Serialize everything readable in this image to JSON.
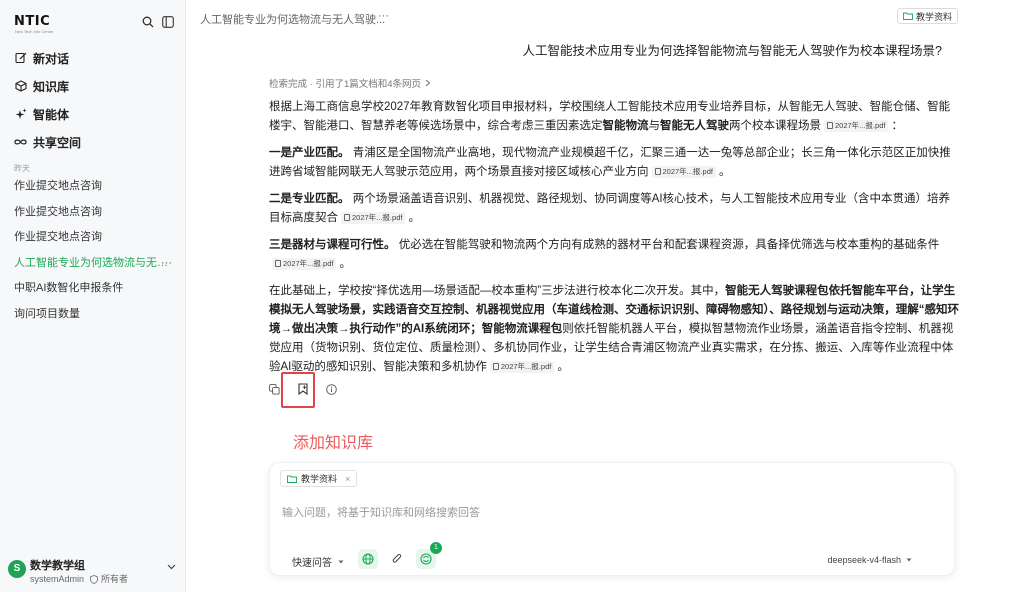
{
  "sidebar": {
    "logo": "NTIC",
    "logo_sub": "New Tech Info Center",
    "nav": [
      {
        "label": "新对话",
        "icon": "edit-icon"
      },
      {
        "label": "知识库",
        "icon": "cube-icon"
      },
      {
        "label": "智能体",
        "icon": "sparkle-icon"
      },
      {
        "label": "共享空间",
        "icon": "infinity-icon"
      }
    ],
    "section_label": "昨天",
    "history": [
      {
        "label": "作业提交地点咨询"
      },
      {
        "label": "作业提交地点咨询"
      },
      {
        "label": "作业提交地点咨询"
      },
      {
        "label": "人工智能专业为何选物流与无…",
        "active": true,
        "more": "···"
      },
      {
        "label": "中职AI数智化申报条件"
      },
      {
        "label": "询问项目数量"
      }
    ],
    "group": {
      "avatar": "S",
      "name": "数学教学组",
      "user": "systemAdmin",
      "role": "所有者"
    }
  },
  "topbar": {
    "title": "人工智能专业为何选物流与无人驾驶...",
    "more": "···",
    "kb_tag": "教学资料"
  },
  "question": "人工智能技术应用专业为何选择智能物流与智能无人驾驶作为校本课程场景?",
  "answer": {
    "retrieval": "检索完成 · 引用了1篇文档和4条网页",
    "cite_label": "2027年...报.pdf",
    "p1": [
      "根据上海工商信息学校2027年教育数智化项目申报材料，学校围绕人工智能技术应用专业培养目标，从智能无人驾驶、智能仓储、智能楼宇、智能港口、智慧养老等候选场景中，综合考虑三重因素选定",
      "智能物流",
      "与",
      "智能无人驾驶",
      "两个校本课程场景",
      "："
    ],
    "p2": [
      "一是产业匹配。",
      " 青浦区是全国物流产业高地，现代物流产业规模超千亿，汇聚三通一达一兔等总部企业；长三角一体化示范区正加快推进跨省域智能网联无人驾驶示范应用，两个场景直接对接区域核心产业方向",
      "。"
    ],
    "p3": [
      "二是专业匹配。",
      " 两个场景涵盖语音识别、机器视觉、路径规划、协同调度等AI核心技术，与人工智能技术应用专业（含中本贯通）培养目标高度契合",
      "。"
    ],
    "p4": [
      "三是器材与课程可行性。",
      " 优必选在智能驾驶和物流两个方向有成熟的器材平台和配套课程资源，具备择优筛选与校本重构的基础条件",
      "。"
    ],
    "p5": [
      "在此基础上，学校按“择优选用—场景适配—校本重构”三步法进行校本化二次开发。其中，",
      "智能无人驾驶课程包依托智能车平台，让学生模拟无人驾驶场景，实践语音交互控制、机器视觉应用（车道线检测、交通标识识别、障碍物感知）、路径规划与运动决策，理解“感知环境→做出决策→执行动作”的AI系统闭环；",
      "智能物流课程包",
      "则依托智能机器人平台，模拟智慧物流作业场景，涵盖语音指令控制、机器视觉应用（货物识别、货位定位、质量检测）、多机协同作业，让学生结合青浦区物流产业真实需求，在分拣、搬运、入库等作业流程中体验AI驱动的感知识别、智能决策和多机协作",
      "。"
    ]
  },
  "annotation": "添加知识库",
  "input": {
    "kb_chip": "教学资料",
    "placeholder": "输入问题，将基于知识库和网络搜索回答",
    "quick_ask": "快速问答",
    "badge": "1",
    "model": "deepseek-v4-flash"
  },
  "colors": {
    "accent": "#1aaa55",
    "highlight": "#e0454a",
    "annotation": "#ef5a5a"
  }
}
